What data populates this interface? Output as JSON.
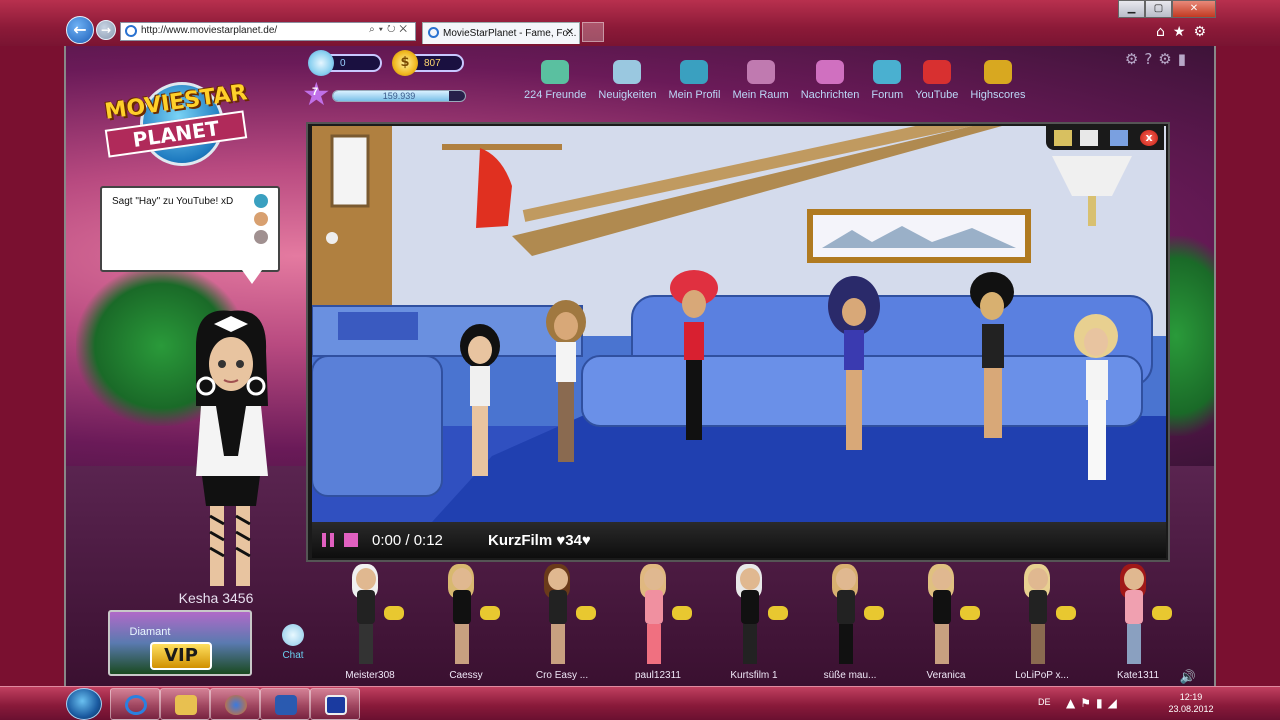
{
  "browser": {
    "url": "http://www.moviestarplanet.de/",
    "tab_title": "MovieStarPlanet - Fame, Fo...",
    "back_glyph": "←",
    "forward_glyph": "→",
    "addr_tools": "⌕▾↻✕",
    "tab_close": "✕",
    "win_min": "▁",
    "win_max": "▢",
    "win_close": "✕",
    "toolbar_icons": "⌂★⚙"
  },
  "game": {
    "logo_line1": "MOVIESTAR",
    "logo_line2": "PLANET",
    "diamonds": "0",
    "coins": "807",
    "coin_glyph": "$",
    "level": "7",
    "fame": "159.939",
    "fame_progress": 0.88,
    "settings_icons": "⚙?⚙▮",
    "nav": [
      {
        "label": "224 Freunde",
        "color": "#5ac0a0"
      },
      {
        "label": "Neuigkeiten",
        "color": "#9ac8e0"
      },
      {
        "label": "Mein Profil",
        "color": "#3aa0c0"
      },
      {
        "label": "Mein Raum",
        "color": "#c07ab0"
      },
      {
        "label": "Nachrichten",
        "color": "#d070c0"
      },
      {
        "label": "Forum",
        "color": "#4ab0d0"
      },
      {
        "label": "YouTube",
        "color": "#d83030"
      },
      {
        "label": "Highscores",
        "color": "#d8a820"
      }
    ],
    "chat_bubble_text": "Sagt \"Hay\" zu YouTube! xD",
    "avatar_name": "Kesha 3456",
    "vip_label": "Diamant",
    "vip_badge": "VIP",
    "chat_label": "Chat",
    "speaker_glyph": "🔊"
  },
  "video": {
    "time": "0:00 / 0:12",
    "title": "KurzFilm ♥34♥",
    "close_glyph": "x"
  },
  "friends": [
    {
      "name": "Meister308",
      "hair": "#f0f0f0",
      "body": "#222",
      "legs": "#333"
    },
    {
      "name": "Caessy",
      "hair": "#d8b870",
      "body": "#111",
      "legs": "#c8a080"
    },
    {
      "name": "Cro Easy ...",
      "hair": "#6a3a1a",
      "body": "#222",
      "legs": "#c8a080"
    },
    {
      "name": "paul12311",
      "hair": "#e0b880",
      "body": "#f090a0",
      "legs": "#f07080"
    },
    {
      "name": "Kurtsfilm 1",
      "hair": "#e8e8e8",
      "body": "#111",
      "legs": "#222"
    },
    {
      "name": "süße mau...",
      "hair": "#d8b070",
      "body": "#222",
      "legs": "#111"
    },
    {
      "name": "Veranica",
      "hair": "#e0c080",
      "body": "#111",
      "legs": "#c8a080"
    },
    {
      "name": "LoLiPoP x...",
      "hair": "#e8d090",
      "body": "#222",
      "legs": "#8a6a50"
    },
    {
      "name": "Kate1311",
      "hair": "#a01818",
      "body": "#f0a0b0",
      "legs": "#8aa0c0"
    }
  ],
  "taskbar": {
    "lang": "DE",
    "tray_icons": "▲⚑▮◢",
    "time": "12:19",
    "date": "23.08.2012"
  }
}
